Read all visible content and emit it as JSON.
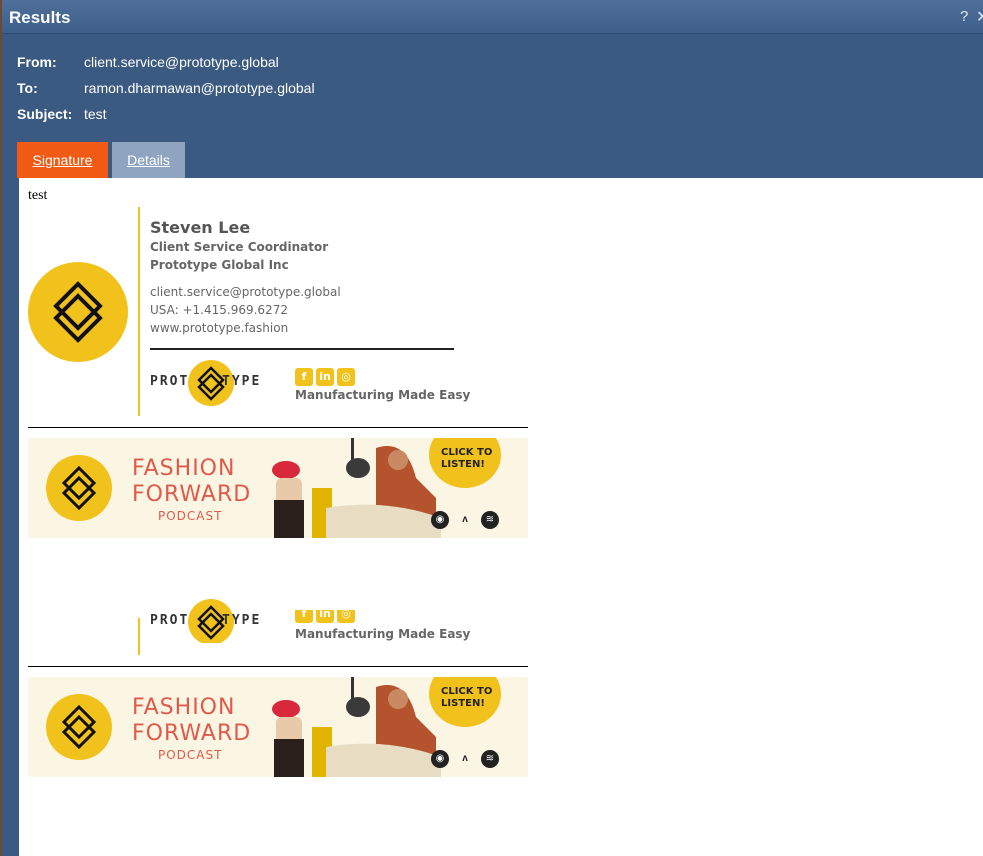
{
  "window": {
    "title": "Results",
    "help_label": "?",
    "close_label": "✕"
  },
  "header": {
    "from_label": "From:",
    "from_value": "client.service@prototype.global",
    "to_label": "To:",
    "to_value": "ramon.dharmawan@prototype.global",
    "subject_label": "Subject:",
    "subject_value": "test"
  },
  "tabs": [
    {
      "label": "Signature"
    },
    {
      "label": "Details"
    }
  ],
  "message": {
    "body": "test"
  },
  "signature": {
    "name": "Steven Lee",
    "job_title": "Client Service Coordinator",
    "company": "Prototype Global Inc",
    "email": "client.service@prototype.global",
    "phone": "USA: +1.415.969.6272",
    "website": "www.prototype.fashion",
    "wordmark_left": "PROT",
    "wordmark_right": "TYPE",
    "social_icons": [
      "facebook-icon",
      "linkedin-icon",
      "instagram-icon"
    ],
    "tagline": "Manufacturing Made Easy"
  },
  "banner": {
    "line1": "FASHION",
    "line2": "FORWARD",
    "line3": "PODCAST",
    "cta_line1": "CLICK TO",
    "cta_line2": "LISTEN!",
    "podcast_icons": [
      "apple-podcasts-icon",
      "anchor-icon",
      "spotify-icon"
    ]
  },
  "colors": {
    "accent": "#f2c21c",
    "tab_active": "#f05a14",
    "dialog": "#3b5a82",
    "banner_text": "#e05a4a"
  }
}
